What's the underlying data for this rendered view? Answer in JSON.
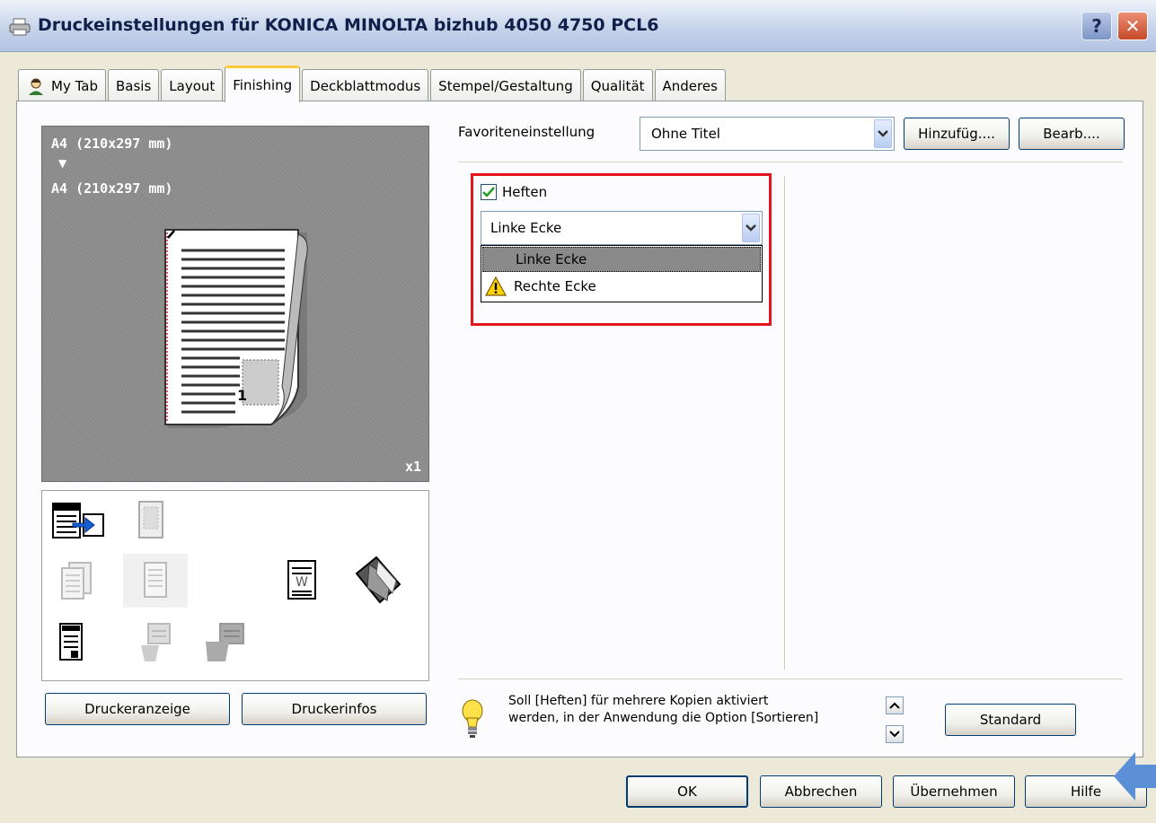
{
  "window": {
    "title": "Druckeinstellungen für KONICA MINOLTA bizhub 4050 4750 PCL6",
    "help_label": "?",
    "close_label": "✕"
  },
  "tabs": [
    {
      "label": "My Tab",
      "active": false
    },
    {
      "label": "Basis",
      "active": false
    },
    {
      "label": "Layout",
      "active": false
    },
    {
      "label": "Finishing",
      "active": true
    },
    {
      "label": "Deckblattmodus",
      "active": false
    },
    {
      "label": "Stempel/Gestaltung",
      "active": false
    },
    {
      "label": "Qualität",
      "active": false
    },
    {
      "label": "Anderes",
      "active": false
    }
  ],
  "preview": {
    "paper_from": "A4 (210x297 mm)",
    "paper_to": "A4 (210x297 mm)",
    "copies": "x1",
    "page_number": "1"
  },
  "left_buttons": {
    "printer_view": "Druckeranzeige",
    "printer_info": "Druckerinfos"
  },
  "favorites": {
    "label": "Favoriteneinstellung",
    "value": "Ohne Titel",
    "add_label": "Hinzufüg....",
    "edit_label": "Bearb...."
  },
  "staple": {
    "checkbox_label": "Heften",
    "checked": true,
    "selected": "Linke Ecke",
    "options": [
      "Linke Ecke",
      "Rechte Ecke"
    ]
  },
  "info": {
    "text_line1": "Soll [Heften] für mehrere Kopien aktiviert",
    "text_line2": "werden, in der Anwendung die Option [Sortieren]"
  },
  "standard_label": "Standard",
  "footer": {
    "ok": "OK",
    "cancel": "Abbrechen",
    "apply": "Übernehmen",
    "help": "Hilfe"
  },
  "colors": {
    "highlight": "#e3141c",
    "active_tab_accent": "#ffc83c",
    "annotation_arrow": "#5b8fd6"
  }
}
